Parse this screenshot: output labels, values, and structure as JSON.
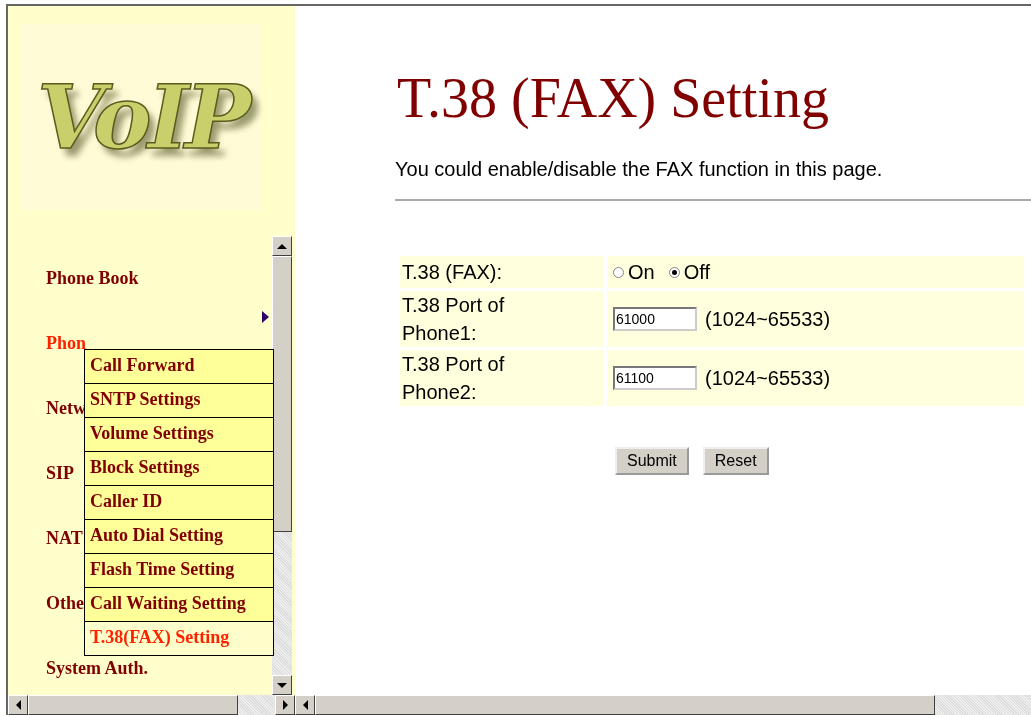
{
  "logo": {
    "text": "VoIP"
  },
  "sidebar": {
    "items": [
      {
        "label": "Phone Book",
        "selected": false,
        "submenu_arrow": true
      },
      {
        "label": "Phon",
        "selected": true,
        "submenu_arrow": false
      },
      {
        "label": "Netw",
        "selected": false,
        "submenu_arrow": false
      },
      {
        "label": "SIP",
        "selected": false,
        "submenu_arrow": false
      },
      {
        "label": "NAT",
        "selected": false,
        "submenu_arrow": false
      },
      {
        "label": "Othe",
        "selected": false,
        "submenu_arrow": false
      },
      {
        "label": "System Auth.",
        "selected": false,
        "submenu_arrow": false
      }
    ]
  },
  "submenu": {
    "items": [
      {
        "label": "Call Forward",
        "selected": false
      },
      {
        "label": "SNTP Settings",
        "selected": false
      },
      {
        "label": "Volume Settings",
        "selected": false
      },
      {
        "label": "Block Settings",
        "selected": false
      },
      {
        "label": "Caller ID",
        "selected": false
      },
      {
        "label": "Auto Dial Setting",
        "selected": false
      },
      {
        "label": "Flash Time Setting",
        "selected": false
      },
      {
        "label": "Call Waiting Setting",
        "selected": false
      },
      {
        "label": "T.38(FAX) Setting",
        "selected": true
      }
    ]
  },
  "main": {
    "title": "T.38 (FAX) Setting",
    "description": "You could enable/disable the FAX function in this page.",
    "form": {
      "rows": [
        {
          "kind": "radio",
          "label": "T.38 (FAX):",
          "options": [
            {
              "label": "On",
              "selected": false
            },
            {
              "label": "Off",
              "selected": true
            }
          ]
        },
        {
          "kind": "text",
          "label": "T.38 Port of Phone1:",
          "value": "61000",
          "range": "(1024~65533)"
        },
        {
          "kind": "text",
          "label": "T.38 Port of Phone2:",
          "value": "61100",
          "range": "(1024~65533)"
        }
      ]
    },
    "buttons": [
      "Submit",
      "Reset"
    ]
  }
}
